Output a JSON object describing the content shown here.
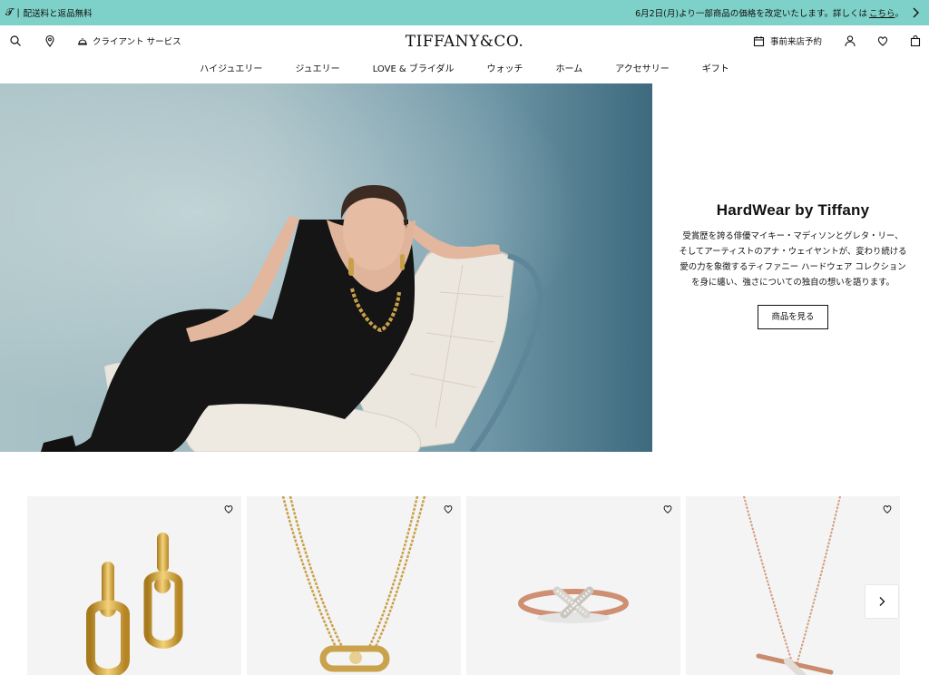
{
  "banner": {
    "left_text": "配送料と返品無料",
    "right_text": "6月2日(月)より一部商品の価格を改定いたします。詳しくは",
    "right_link": "こちら"
  },
  "header": {
    "client_service": "クライアント サービス",
    "logo": "TIFFANY&CO.",
    "appointment": "事前来店予約"
  },
  "nav": {
    "items": [
      "ハイジュエリー",
      "ジュエリー",
      "LOVE & ブライダル",
      "ウォッチ",
      "ホーム",
      "アクセサリー",
      "ギフト"
    ]
  },
  "hero": {
    "title": "HardWear by Tiffany",
    "body_lines": [
      "受賞歴を誇る俳優マイキー・マディソンとグレタ・リー、",
      "そしてアーティストのアナ・ウェイヤントが、変わり続ける",
      "愛の力を象徴するティファニー ハードウェア コレクション",
      "を身に纏い、強さについての独自の想いを語ります。"
    ],
    "cta": "商品を見る"
  },
  "icons": {
    "search": "search-icon",
    "location": "location-pin-icon",
    "client": "concierge-bell-icon",
    "calendar": "calendar-icon",
    "account": "user-icon",
    "wishlist": "heart-icon",
    "bag": "shopping-bag-icon",
    "sound": "speaker-muted-icon",
    "pause": "pause-icon",
    "next": "chevron-right-icon"
  },
  "colors": {
    "banner": "#7ed1c8",
    "gold": "#d4a843",
    "rose_gold": "#d89a7c"
  }
}
